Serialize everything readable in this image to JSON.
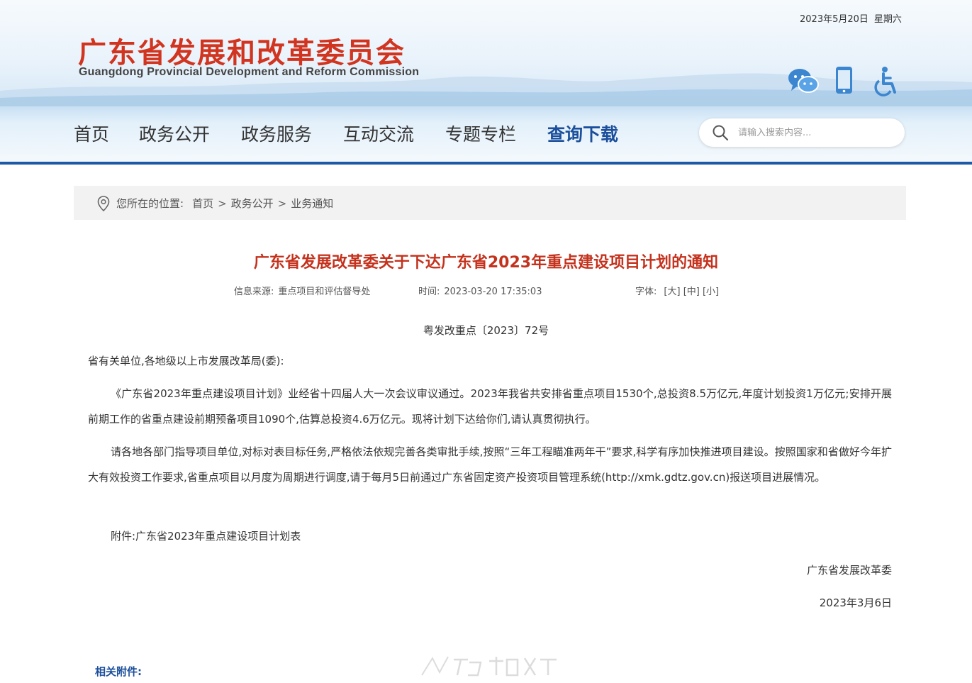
{
  "header": {
    "date": "2023年5月20日",
    "weekday": "星期六",
    "logo_cn": "广东省发展和改革委员会",
    "logo_en": "Guangdong Provincial Development and Reform Commission",
    "icons": [
      "wechat-icon",
      "mobile-icon",
      "accessibility-icon"
    ]
  },
  "nav": {
    "items": [
      "首页",
      "政务公开",
      "政务服务",
      "互动交流",
      "专题专栏",
      "查询下载"
    ],
    "active_index": 5,
    "search_placeholder": "请输入搜索内容..."
  },
  "breadcrumb": {
    "label": "您所在的位置:",
    "items": [
      "首页",
      "政务公开",
      "业务通知"
    ],
    "separator": ">"
  },
  "article": {
    "title": "广东省发展改革委关于下达广东省2023年重点建设项目计划的通知",
    "source_label": "信息来源:",
    "source": "重点项目和评估督导处",
    "time_label": "时间:",
    "time": "2023-03-20 17:35:03",
    "font_label": "字体:",
    "font_sizes": [
      "[大]",
      "[中]",
      "[小]"
    ],
    "doc_no": "粤发改重点〔2023〕72号",
    "salutation": "省有关单位,各地级以上市发展改革局(委):",
    "paragraph1": "《广东省2023年重点建设项目计划》业经省十四届人大一次会议审议通过。2023年我省共安排省重点项目1530个,总投资8.5万亿元,年度计划投资1万亿元;安排开展前期工作的省重点建设前期预备项目1090个,估算总投资4.6万亿元。现将计划下达给你们,请认真贯彻执行。",
    "paragraph2": "请各地各部门指导项目单位,对标对表目标任务,严格依法依规完善各类审批手续,按照“三年工程瞄准两年干”要求,科学有序加快推进项目建设。按照国家和省做好今年扩大有效投资工作要求,省重点项目以月度为周期进行调度,请于每月5日前通过广东省固定资产投资项目管理系统(http://xmk.gdtz.gov.cn)报送项目进展情况。",
    "attachment": "附件:广东省2023年重点建设项目计划表",
    "signature": "广东省发展改革委",
    "sign_date": "2023年3月6日",
    "related_label": "相关附件:"
  },
  "colors": {
    "logo_red": "#d1341f",
    "title_red": "#c4321d",
    "nav_active": "#1b4f9c",
    "nav_line": "#1e58a8"
  }
}
